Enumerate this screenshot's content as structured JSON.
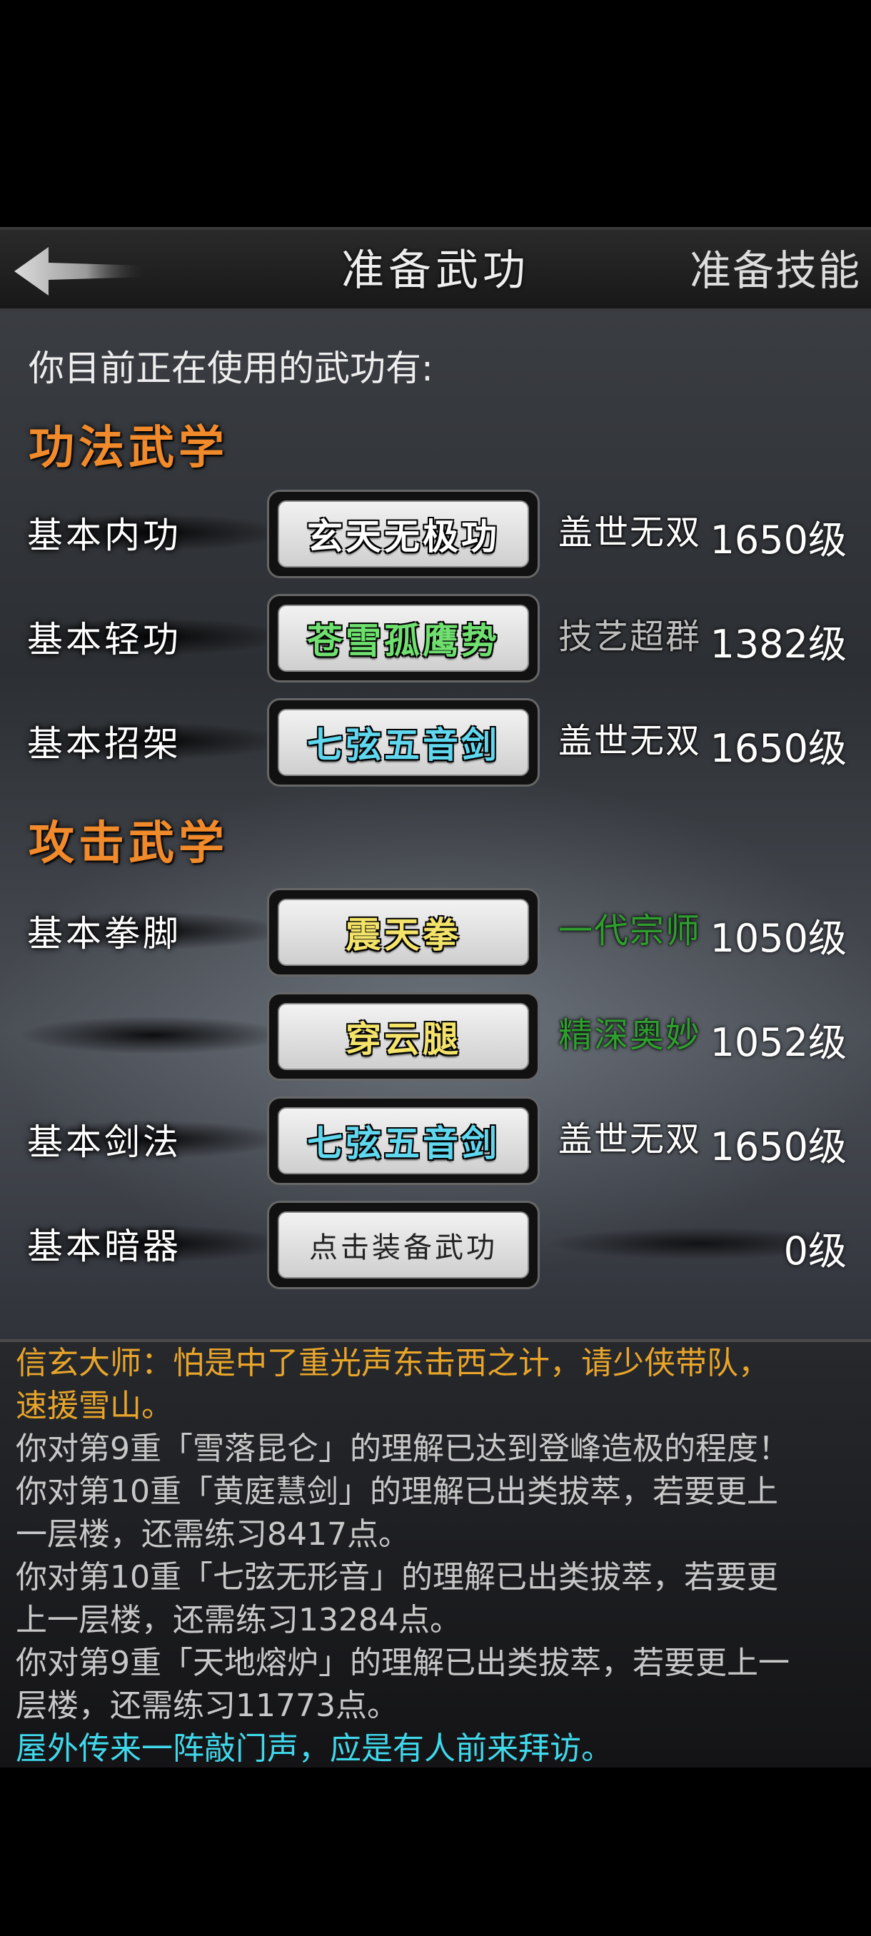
{
  "header": {
    "title": "准备武功",
    "skills_tab": "准备技能"
  },
  "intro": "你目前正在使用的武功有:",
  "sections": [
    {
      "title": "功法武学",
      "rows": [
        {
          "label": "基本内功",
          "skill": "玄天无极功",
          "skill_color": "#ffffff",
          "rank": "盖世无双",
          "rank_color": "#ffffff",
          "level": "1650级"
        },
        {
          "label": "基本轻功",
          "skill": "苍雪孤鹰势",
          "skill_color": "#6fe06f",
          "rank": "技艺超群",
          "rank_color": "#bdbdbd",
          "level": "1382级"
        },
        {
          "label": "基本招架",
          "skill": "七弦五音剑",
          "skill_color": "#5fd7ee",
          "rank": "盖世无双",
          "rank_color": "#ffffff",
          "level": "1650级"
        }
      ]
    },
    {
      "title": "攻击武学",
      "rows": [
        {
          "label": "基本拳脚",
          "skill": "震天拳",
          "skill_color": "#f3e36a",
          "rank": "一代宗师",
          "rank_color": "#2f9e2f",
          "level": "1050级"
        },
        {
          "label": "",
          "skill": "穿云腿",
          "skill_color": "#f3e36a",
          "rank": "精深奥妙",
          "rank_color": "#2f9e2f",
          "level": "1052级"
        },
        {
          "label": "基本剑法",
          "skill": "七弦五音剑",
          "skill_color": "#5fd7ee",
          "rank": "盖世无双",
          "rank_color": "#ffffff",
          "level": "1650级"
        },
        {
          "label": "基本暗器",
          "skill": "点击装备武功",
          "skill_color": "#222222",
          "rank": "",
          "rank_color": "#ffffff",
          "level": "0级"
        }
      ]
    }
  ],
  "log": [
    {
      "text": "信玄大师：怕是中了重光声东击西之计，请少侠带队，",
      "color": "#e8a52a"
    },
    {
      "text": "速援雪山。",
      "color": "#e8a52a"
    },
    {
      "text": "你对第9重「雪落昆仑」的理解已达到登峰造极的程度！",
      "color": "#c8c8c8"
    },
    {
      "text": "你对第10重「黄庭慧剑」的理解已出类拔萃，若要更上",
      "color": "#c8c8c8"
    },
    {
      "text": "一层楼，还需练习8417点。",
      "color": "#c8c8c8"
    },
    {
      "text": "你对第10重「七弦无形音」的理解已出类拔萃，若要更",
      "color": "#c8c8c8"
    },
    {
      "text": "上一层楼，还需练习13284点。",
      "color": "#c8c8c8"
    },
    {
      "text": "你对第9重「天地熔炉」的理解已出类拔萃，若要更上一",
      "color": "#c8c8c8"
    },
    {
      "text": "层楼，还需练习11773点。",
      "color": "#c8c8c8"
    },
    {
      "text": "屋外传来一阵敲门声，应是有人前来拜访。",
      "color": "#3fd9ec"
    }
  ]
}
